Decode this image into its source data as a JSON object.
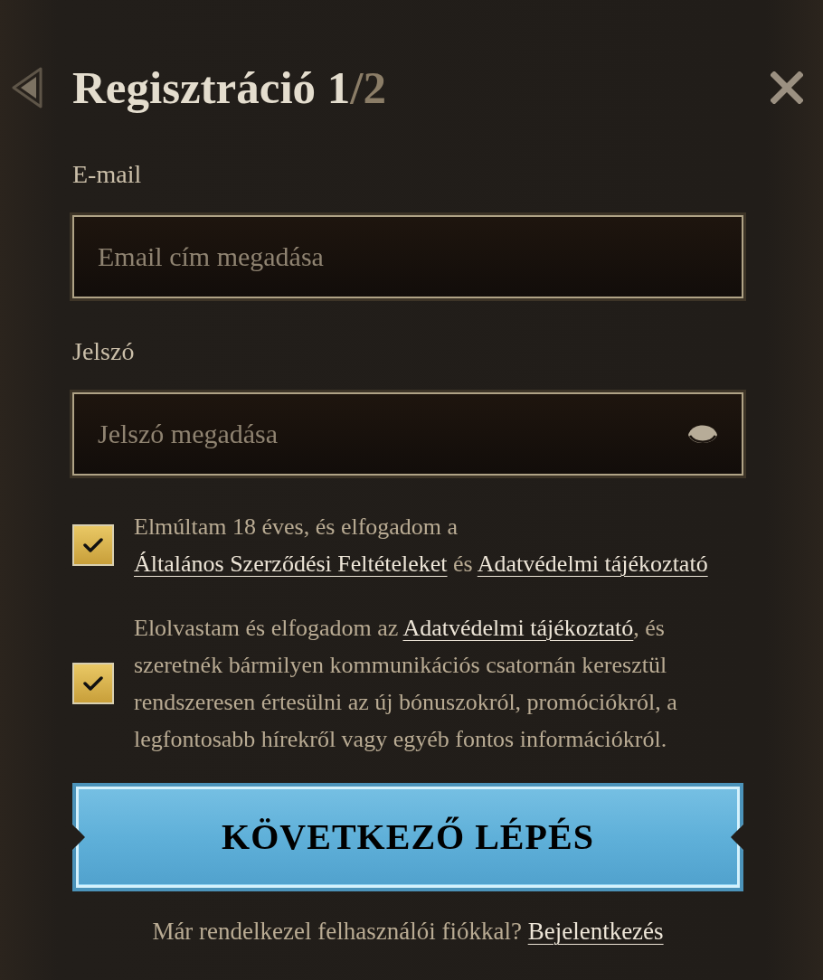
{
  "header": {
    "title": "Regisztráció 1",
    "title_total": "/2"
  },
  "fields": [
    {
      "kind": "email",
      "label": "E-mail",
      "placeholder": "Email cím megadása"
    },
    {
      "kind": "password",
      "label": "Jelszó",
      "placeholder": "Jelszó megadása"
    }
  ],
  "consents": [
    {
      "checked": true,
      "parts": [
        {
          "kind": "text",
          "text": "Elmúltam 18 éves, és elfogadom a "
        },
        {
          "kind": "link",
          "text": "Általános Szerződési Feltételeket"
        },
        {
          "kind": "text",
          "text": " és "
        },
        {
          "kind": "link",
          "text": "Adatvédelmi tájékoztató"
        }
      ]
    },
    {
      "checked": true,
      "parts": [
        {
          "kind": "text",
          "text": "Elolvastam és elfogadom az "
        },
        {
          "kind": "link",
          "text": "Adatvédelmi tájékoztató"
        },
        {
          "kind": "text",
          "text": ", és szeretnék bármilyen kommunikációs csatornán keresztül rendszeresen értesülni az új bónuszokról, promóciókról, a legfontosabb hírekről vagy egyéb fontos információkról."
        }
      ]
    }
  ],
  "next_button": {
    "label": "KÖVETKEZŐ LÉPÉS"
  },
  "login_prompt": {
    "text": "Már rendelkezel felhasználói fiókkal?",
    "link": "Bejelentkezés"
  }
}
